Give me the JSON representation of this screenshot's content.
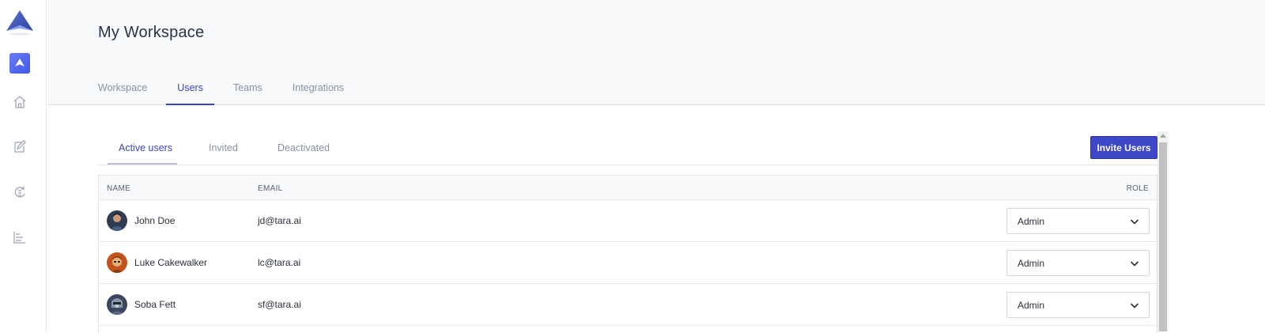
{
  "header": {
    "title": "My Workspace",
    "tabs": [
      {
        "label": "Workspace"
      },
      {
        "label": "Users"
      },
      {
        "label": "Teams"
      },
      {
        "label": "Integrations"
      }
    ],
    "active_tab": "Users"
  },
  "sidebar": {
    "icons": [
      "home-icon",
      "edit-icon",
      "sync-icon",
      "gantt-icon"
    ]
  },
  "users_panel": {
    "subtabs": [
      {
        "label": "Active users"
      },
      {
        "label": "Invited"
      },
      {
        "label": "Deactivated"
      }
    ],
    "active_subtab": "Active users",
    "invite_label": "Invite Users",
    "columns": {
      "name": "NAME",
      "email": "EMAIL",
      "role": "ROLE"
    },
    "rows": [
      {
        "name": "John Doe",
        "email": "jd@tara.ai",
        "role": "Admin"
      },
      {
        "name": "Luke Cakewalker",
        "email": "lc@tara.ai",
        "role": "Admin"
      },
      {
        "name": "Soba Fett",
        "email": "sf@tara.ai",
        "role": "Admin"
      }
    ]
  },
  "colors": {
    "accent": "#3d47c8",
    "active_tab": "#3c45b8",
    "muted_text": "#8a90a2",
    "header_bg": "#f8f9fb"
  }
}
